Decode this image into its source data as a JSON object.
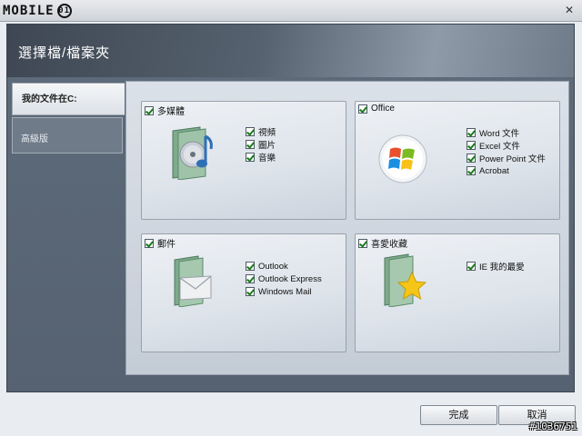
{
  "window": {
    "logo_text": "MOBILE",
    "logo_mark": "01",
    "close_glyph": "✕"
  },
  "header": {
    "title": "選擇檔/檔案夾"
  },
  "sidebar": {
    "items": [
      {
        "label": "我的文件在C:",
        "active": true
      },
      {
        "label": "高級版",
        "active": false
      }
    ]
  },
  "groups": {
    "multimedia": {
      "title": "多媒體",
      "icon": "media-folder-icon",
      "items": [
        "視頻",
        "圖片",
        "音樂"
      ]
    },
    "office": {
      "title": "Office",
      "icon": "windows-logo-icon",
      "items": [
        "Word 文件",
        "Excel 文件",
        "Power Point 文件",
        "Acrobat"
      ]
    },
    "mail": {
      "title": "郵件",
      "icon": "mail-folder-icon",
      "items": [
        "Outlook",
        "Outlook Express",
        "Windows Mail"
      ]
    },
    "favorites": {
      "title": "喜愛收藏",
      "icon": "favorites-folder-icon",
      "items": [
        "IE 我的最愛"
      ]
    }
  },
  "footer": {
    "finish_label": "完成",
    "cancel_label": "取消",
    "watermark": "#1036751"
  },
  "colors": {
    "panel_dark": "#4c5765",
    "content_bg": "#dbe1e8",
    "check_green": "#1a7a1a"
  }
}
